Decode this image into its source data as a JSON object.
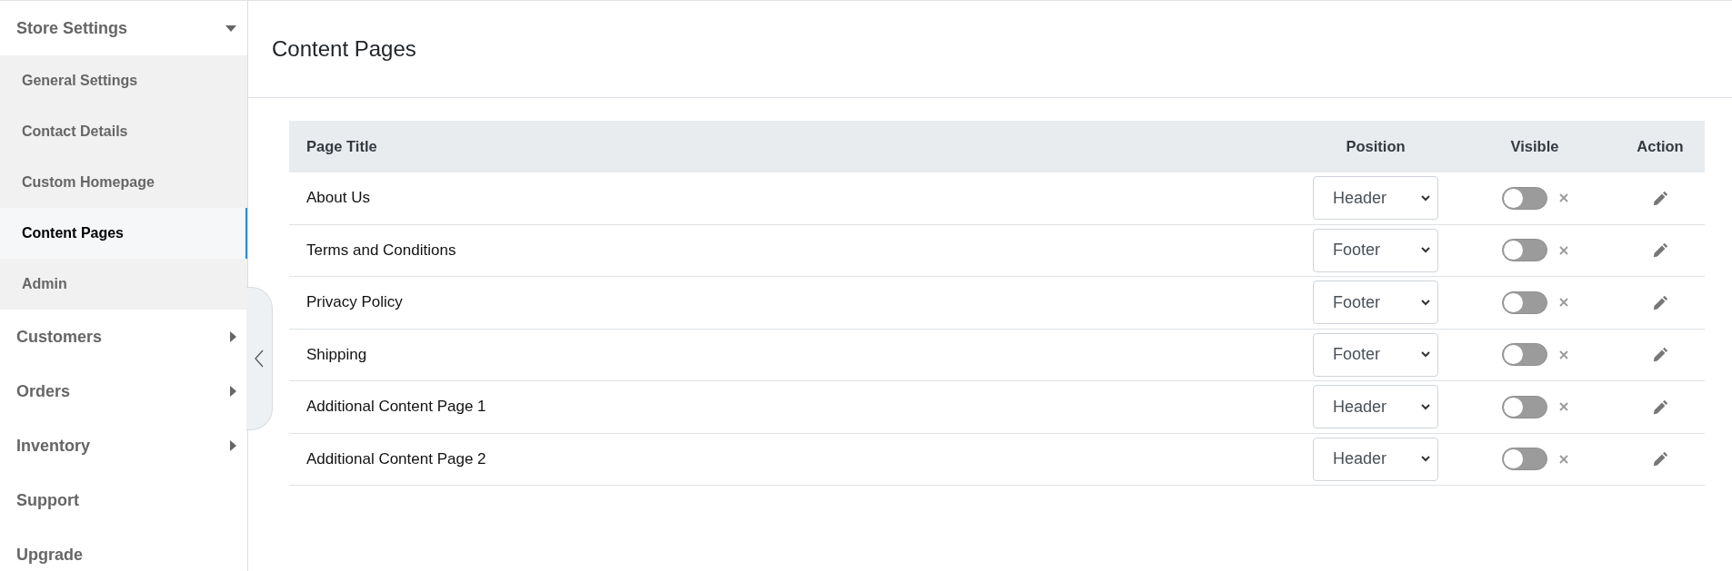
{
  "sidebar": {
    "items": [
      {
        "label": "Store Settings",
        "kind": "group",
        "expanded": true,
        "selected": false,
        "children": [
          {
            "label": "General Settings",
            "selected": false
          },
          {
            "label": "Contact Details",
            "selected": false
          },
          {
            "label": "Custom Homepage",
            "selected": false
          },
          {
            "label": "Content Pages",
            "selected": true
          },
          {
            "label": "Admin",
            "selected": false
          }
        ]
      },
      {
        "label": "Customers",
        "kind": "group",
        "expanded": false,
        "selected": false
      },
      {
        "label": "Orders",
        "kind": "group",
        "expanded": false,
        "selected": false
      },
      {
        "label": "Inventory",
        "kind": "group",
        "expanded": false,
        "selected": false
      },
      {
        "label": "Support",
        "kind": "link",
        "selected": false
      },
      {
        "label": "Upgrade",
        "kind": "link",
        "selected": false
      }
    ]
  },
  "page": {
    "title": "Content Pages"
  },
  "table": {
    "columns": [
      "Page Title",
      "Position",
      "Visible",
      "Action"
    ],
    "rows": [
      {
        "title": "About Us",
        "position": "Header",
        "visible": false
      },
      {
        "title": "Terms and Conditions",
        "position": "Footer",
        "visible": false
      },
      {
        "title": "Privacy Policy",
        "position": "Footer",
        "visible": false
      },
      {
        "title": "Shipping",
        "position": "Footer",
        "visible": false
      },
      {
        "title": "Additional Content Page 1",
        "position": "Header",
        "visible": false
      },
      {
        "title": "Additional Content Page 2",
        "position": "Header",
        "visible": false
      }
    ]
  }
}
